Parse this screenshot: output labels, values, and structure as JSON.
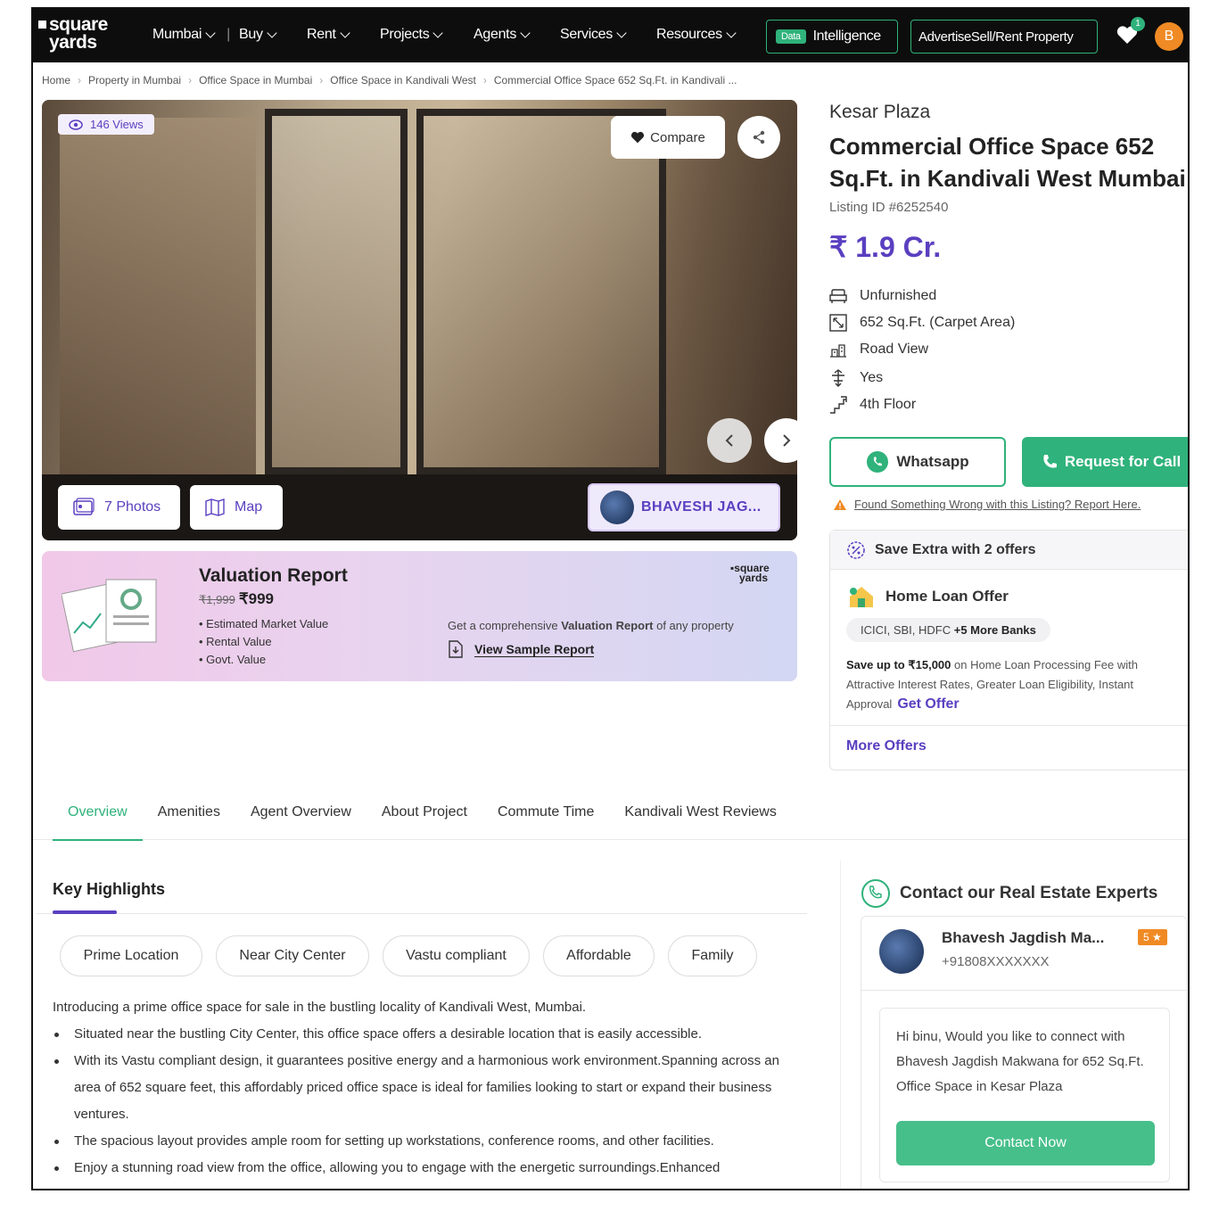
{
  "nav": {
    "logo": "square yards",
    "logo_line1": "square",
    "logo_line2": "yards",
    "city": "Mumbai",
    "menu": [
      "Buy",
      "Rent",
      "Projects",
      "Agents",
      "Services",
      "Resources"
    ],
    "data_badge": "Data",
    "data_label": "Intelligence",
    "advertise_label": "AdvertiseSell/Rent Property",
    "badge_count": "1",
    "user_initial": "B"
  },
  "breadcrumb": [
    "Home",
    "Property in Mumbai",
    "Office Space in Mumbai",
    "Office Space in Kandivali West",
    "Commercial Office Space 652 Sq.Ft. in Kandivali ..."
  ],
  "gallery": {
    "views": "146 Views",
    "compare": "Compare",
    "photos": "7 Photos",
    "map": "Map",
    "agent": "BHAVESH JAG..."
  },
  "valuation": {
    "title": "Valuation Report",
    "old_price": "₹1,999",
    "price": "₹999",
    "items": [
      "Estimated Market Value",
      "Rental Value",
      "Govt. Value"
    ],
    "desc_pre": "Get a comprehensive ",
    "desc_bold": "Valuation Report",
    "desc_post": " of any property",
    "link": "View Sample Report",
    "logo_line1": "square",
    "logo_line2": "yards"
  },
  "listing": {
    "building": "Kesar Plaza",
    "title": "Commercial Office Space 652 Sq.Ft. in Kandivali West Mumbai",
    "listing_id": "Listing ID #6252540",
    "price": "₹ 1.9 Cr.",
    "features": [
      {
        "icon": "sofa-icon",
        "text": "Unfurnished"
      },
      {
        "icon": "area-icon",
        "text": "652 Sq.Ft. (Carpet Area)"
      },
      {
        "icon": "road-view-icon",
        "text": "Road View"
      },
      {
        "icon": "lift-icon",
        "text": "Yes"
      },
      {
        "icon": "floor-icon",
        "text": "4th Floor"
      }
    ],
    "whatsapp": "Whatsapp",
    "request_call": "Request for Call",
    "report": "Found Something Wrong with this Listing? Report Here."
  },
  "offers": {
    "header": "Save Extra with 2 offers",
    "title": "Home Loan Offer",
    "banks_pre": "ICICI, SBI, HDFC ",
    "banks_more": "+5 More Banks",
    "desc_bold": "Save up to ₹15,000",
    "desc": " on Home Loan Processing Fee with Attractive Interest Rates, Greater Loan Eligibility, Instant Approval",
    "get_offer": "Get Offer",
    "more": "More Offers"
  },
  "tabs": [
    "Overview",
    "Amenities",
    "Agent Overview",
    "About Project",
    "Commute Time",
    "Kandivali West Reviews"
  ],
  "highlights": {
    "title": "Key Highlights",
    "chips": [
      "Prime Location",
      "Near City Center",
      "Vastu compliant",
      "Affordable",
      "Family"
    ],
    "intro": "Introducing a prime office space for sale in the bustling locality of Kandivali West, Mumbai.",
    "bullets": [
      "Situated near the bustling City Center, this office space offers a desirable location that is easily accessible.",
      "With its Vastu compliant design, it guarantees positive energy and a harmonious work environment.Spanning across an area of 652 square feet, this affordably priced office space is ideal for families looking to start or expand their business ventures.",
      "The spacious layout provides ample room for setting up workstations, conference rooms, and other facilities.",
      "Enjoy a stunning road view from the office, allowing you to engage with the energetic surroundings.Enhanced"
    ]
  },
  "contact": {
    "title": "Contact our Real Estate Experts",
    "agent_name": "Bhavesh Jagdish Ma...",
    "rating": "5 ★",
    "phone": "+91808XXXXXXX",
    "message": "Hi binu, Would you like to connect with Bhavesh Jagdish Makwana for 652 Sq.Ft. Office Space in Kesar Plaza",
    "button": "Contact Now"
  },
  "colors": {
    "accent": "#5a3fc0",
    "green": "#2fb27b",
    "orange": "#f08a24"
  }
}
